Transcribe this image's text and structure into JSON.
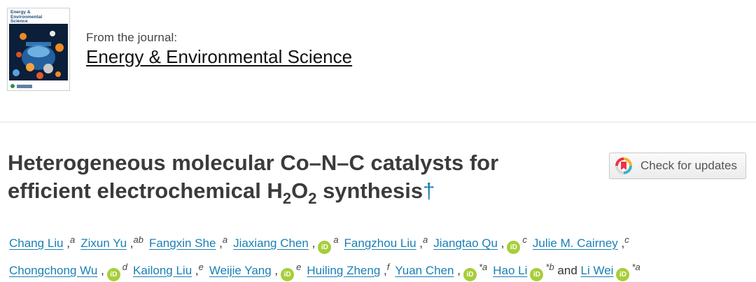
{
  "journal": {
    "cover_title": "Energy & Environmental Science",
    "from_label": "From the journal:",
    "name": "Energy & Environmental Science"
  },
  "article": {
    "title_line1": "Heterogeneous molecular Co–N–C catalysts for",
    "title_line2_pre": "efficient electrochemical H",
    "title_sub1": "2",
    "title_mid": "O",
    "title_sub2": "2",
    "title_line2_post": " synthesis",
    "dagger": "†"
  },
  "updates_button": {
    "label": "Check for updates",
    "icon": "crossmark-icon"
  },
  "authors": [
    {
      "name": "Chang Liu",
      "aff": "a",
      "orcid": false
    },
    {
      "name": "Zixun Yu",
      "aff": "ab",
      "orcid": false
    },
    {
      "name": "Fangxin She",
      "aff": "a",
      "orcid": false
    },
    {
      "name": "Jiaxiang Chen",
      "aff": "a",
      "orcid": true
    },
    {
      "name": "Fangzhou Liu",
      "aff": "a",
      "orcid": false
    },
    {
      "name": "Jiangtao Qu",
      "aff": "c",
      "orcid": true
    },
    {
      "name": "Julie M. Cairney",
      "aff": "c",
      "orcid": false
    },
    {
      "name": "Chongchong Wu",
      "aff": "d",
      "orcid": true
    },
    {
      "name": "Kailong Liu",
      "aff": "e",
      "orcid": false
    },
    {
      "name": "Weijie Yang",
      "aff": "e",
      "orcid": true
    },
    {
      "name": "Huiling Zheng",
      "aff": "f",
      "orcid": false
    },
    {
      "name": "Yuan Chen",
      "aff": "*a",
      "orcid": true
    },
    {
      "name": "Hao Li",
      "aff": "*b",
      "orcid": true
    },
    {
      "name": "Li Wei",
      "aff": "*a",
      "orcid": true
    }
  ],
  "authors_conjunction": "and",
  "orcid_glyph": "iD",
  "colors": {
    "link": "#1a7fb5",
    "orcid": "#a6ce39",
    "title": "#3b3b3b"
  }
}
